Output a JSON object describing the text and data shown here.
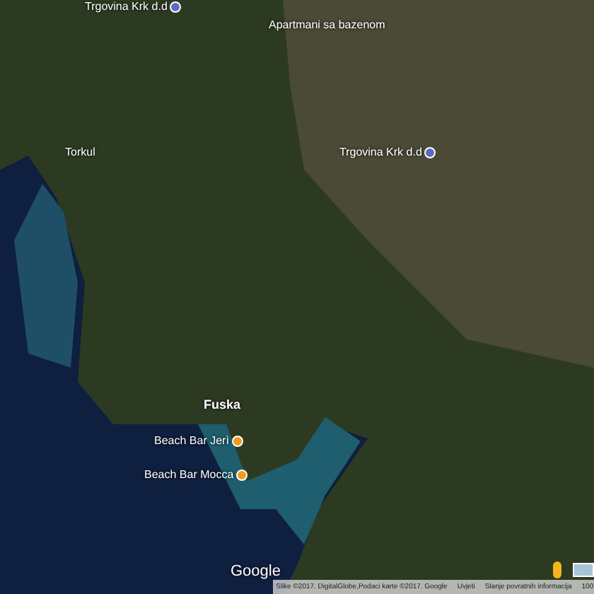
{
  "map": {
    "places": [
      {
        "name": "Trgovina Krk d.d",
        "kind": "shop"
      },
      {
        "name": "Apartmani sa bazenom",
        "kind": "plain"
      },
      {
        "name": "Torkul",
        "kind": "plain"
      },
      {
        "name": "Trgovina Krk d.d",
        "kind": "shop"
      },
      {
        "name": "Fuska",
        "kind": "bold"
      },
      {
        "name": "Beach Bar Jerì",
        "kind": "bar"
      },
      {
        "name": "Beach Bar Mocca",
        "kind": "bar"
      }
    ],
    "logo": "Google",
    "footer": [
      "Slike ©2017. DigitalGlobe,Podaci karte ©2017. Google",
      "Uvjeti",
      "Slanje povratnih informacija",
      "100"
    ]
  }
}
